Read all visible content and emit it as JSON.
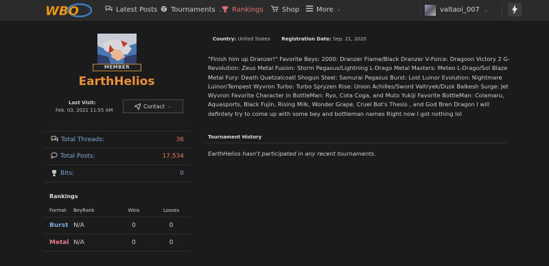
{
  "nav": {
    "logo_text": "WBO",
    "items": [
      {
        "label": "Latest Posts",
        "icon": "comments-icon"
      },
      {
        "label": "Tournaments",
        "icon": "globe-icon"
      },
      {
        "label": "Rankings",
        "icon": "trophy-icon"
      },
      {
        "label": "Shop",
        "icon": "cart-icon"
      },
      {
        "label": "More",
        "icon": "bars-icon"
      }
    ],
    "user": {
      "username": "valtaoi_007"
    },
    "caret": "⌄"
  },
  "profile": {
    "badge": "MEMBER",
    "username": "EarthHelios",
    "last_visit_label": "Last Visit:",
    "last_visit_value": "Feb. 03, 2021  11:55 AM",
    "contact_label": "Contact",
    "country_label": "Country:",
    "country_value": "United States",
    "registration_label": "Registration Date:",
    "registration_value": "Sep. 21, 2020",
    "bio": "\"Finish him up Dranzer!\" Favorite Beys: 2000: Dranzer Flame/Black Dranzer V-Force: Dragoon Victory 2 G-Revolution: Zeus Metal Fusion: Storm Pegasus/Lightning L-Drago Metal Masters: Meteo L-Drago/Sol Blaze Metal Fury: Death Quetzalcoatl Shogun Steel: Samurai Pegasus Burst: Lost Luinor Evolution: Nightmare Luinor/Tempest Wyvron Turbo: Turbo Spryzen Rise: Union Achilles/Sword Valtryek/Dusk Balkesh Surge: Jet Wyvron Favorite Character in BottleMan: Ryo, Cota Coga, and Muto Yukiji Favorite BottleMan: Colamaru, Aquasports, Black Fujin, Rising Milk, Wonder Grape, Cruel Bot's Thesis , and God Bren Dragon I will defintely try to come up with some bey and bottleman names Right now I got nothing lol"
  },
  "stats": [
    {
      "label": "Total Threads:",
      "value": "36",
      "icon": "comments-icon"
    },
    {
      "label": "Total Posts:",
      "value": "17,534",
      "icon": "comment-icon"
    },
    {
      "label": "Bits:",
      "value": "0",
      "icon": "trophy-icon"
    }
  ],
  "rankings": {
    "title": "Rankings",
    "headers": [
      "Format",
      "BeyRank",
      "Wins",
      "Losses"
    ],
    "rows": [
      {
        "format": "Burst",
        "beyrank": "N/A",
        "wins": "0",
        "losses": "0"
      },
      {
        "format": "Metal",
        "beyrank": "N/A",
        "wins": "0",
        "losses": "0"
      }
    ]
  },
  "tournament_history": {
    "title": "Tournament History",
    "empty_text": "EarthHelios hasn't participated in any recent tournaments."
  },
  "colors": {
    "background": "#1b1b1b",
    "topbar": "#2b2b2b",
    "accent_orange": "#e8903a",
    "link_blue": "#7fa8d8",
    "active_red": "#e07070"
  }
}
